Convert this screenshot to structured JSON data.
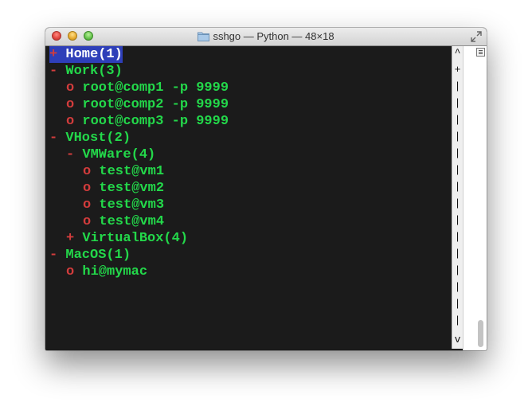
{
  "window": {
    "title": "sshgo — Python — 48×18"
  },
  "tree": [
    {
      "marker": "+",
      "label": "Home(1)",
      "indent": 0,
      "selected": true
    },
    {
      "marker": "-",
      "label": "Work(3)",
      "indent": 0
    },
    {
      "marker": "o",
      "label": "root@comp1 -p 9999",
      "indent": 1
    },
    {
      "marker": "o",
      "label": "root@comp2 -p 9999",
      "indent": 1
    },
    {
      "marker": "o",
      "label": "root@comp3 -p 9999",
      "indent": 1
    },
    {
      "marker": "-",
      "label": "VHost(2)",
      "indent": 0
    },
    {
      "marker": "-",
      "label": "VMWare(4)",
      "indent": 1
    },
    {
      "marker": "o",
      "label": "test@vm1",
      "indent": 2
    },
    {
      "marker": "o",
      "label": "test@vm2",
      "indent": 2
    },
    {
      "marker": "o",
      "label": "test@vm3",
      "indent": 2
    },
    {
      "marker": "o",
      "label": "test@vm4",
      "indent": 2
    },
    {
      "marker": "+",
      "label": "VirtualBox(4)",
      "indent": 1
    },
    {
      "marker": "-",
      "label": "MacOS(1)",
      "indent": 0
    },
    {
      "marker": "o",
      "label": "hi@mymac",
      "indent": 1
    }
  ],
  "scrollbar": {
    "top_arrow": "^",
    "bottom_arrow": "v",
    "position_marker": "+",
    "track_char": "|"
  },
  "colors": {
    "marker": "#d23c3c",
    "label": "#23d84a",
    "selection": "#2e3fb9",
    "background": "#1b1b1b"
  },
  "icons": {
    "close": "close-button-icon",
    "minimize": "minimize-button-icon",
    "zoom": "zoom-button-icon",
    "folder": "folder-icon",
    "fullscreen": "fullscreen-icon",
    "menu": "menu-icon"
  }
}
